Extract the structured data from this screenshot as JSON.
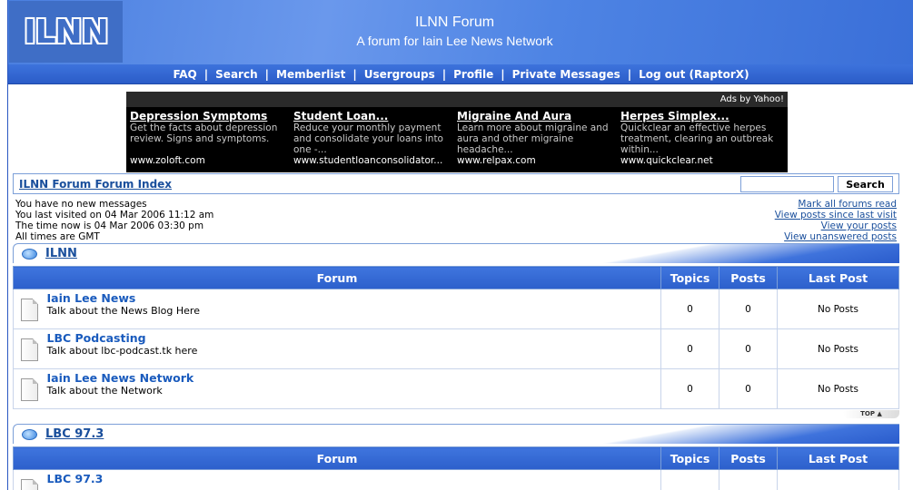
{
  "header": {
    "logo": "ILNN",
    "title": "ILNN Forum",
    "subtitle": "A forum for Iain Lee News Network"
  },
  "nav": {
    "faq": "FAQ",
    "search": "Search",
    "memberlist": "Memberlist",
    "usergroups": "Usergroups",
    "profile": "Profile",
    "private_messages": "Private Messages",
    "logout": "Log out (RaptorX)",
    "separator": "|"
  },
  "ad": {
    "label": "Ads by Yahoo!",
    "items": [
      {
        "title": "Depression Symptoms",
        "desc": "Get the facts about depression review. Signs and symptoms.",
        "url": "www.zoloft.com"
      },
      {
        "title": "Student Loan...",
        "desc": "Reduce your monthly payment and consolidate your loans into one -...",
        "url": "www.studentloanconsolidator..."
      },
      {
        "title": "Migraine And Aura",
        "desc": "Learn more about migraine and aura and other migraine headache...",
        "url": "www.relpax.com"
      },
      {
        "title": "Herpes Simplex...",
        "desc": "Quickclear an effective herpes treatment, clearing an outbreak within...",
        "url": "www.quickclear.net"
      }
    ]
  },
  "index_bar": {
    "link": "ILNN Forum Forum Index",
    "search_value": "",
    "search_button": "Search"
  },
  "info": {
    "messages": "You have no new messages",
    "last_visit": "You last visited on 04 Mar 2006 11:12 am",
    "now": "The time now is 04 Mar 2006 03:30 pm",
    "timezone": "All times are GMT",
    "mark_all": "Mark all forums read",
    "since_last": "View posts since last visit",
    "your_posts": "View your posts",
    "unanswered": "View unanswered posts"
  },
  "columns": {
    "forum": "Forum",
    "topics": "Topics",
    "posts": "Posts",
    "last_post": "Last Post"
  },
  "categories": [
    {
      "name": "ILNN",
      "forums": [
        {
          "name": "Iain Lee News",
          "desc": "Talk about the News Blog Here",
          "topics": "0",
          "posts": "0",
          "last": "No Posts"
        },
        {
          "name": "LBC Podcasting",
          "desc": "Talk about lbc-podcast.tk here",
          "topics": "0",
          "posts": "0",
          "last": "No Posts"
        },
        {
          "name": "Iain Lee News Network",
          "desc": "Talk about the Network",
          "topics": "0",
          "posts": "0",
          "last": "No Posts"
        }
      ]
    },
    {
      "name": "LBC 97.3",
      "forums": [
        {
          "name": "LBC 97.3",
          "desc": "",
          "topics": "",
          "posts": "",
          "last": ""
        }
      ]
    }
  ],
  "top_link": "TOP"
}
